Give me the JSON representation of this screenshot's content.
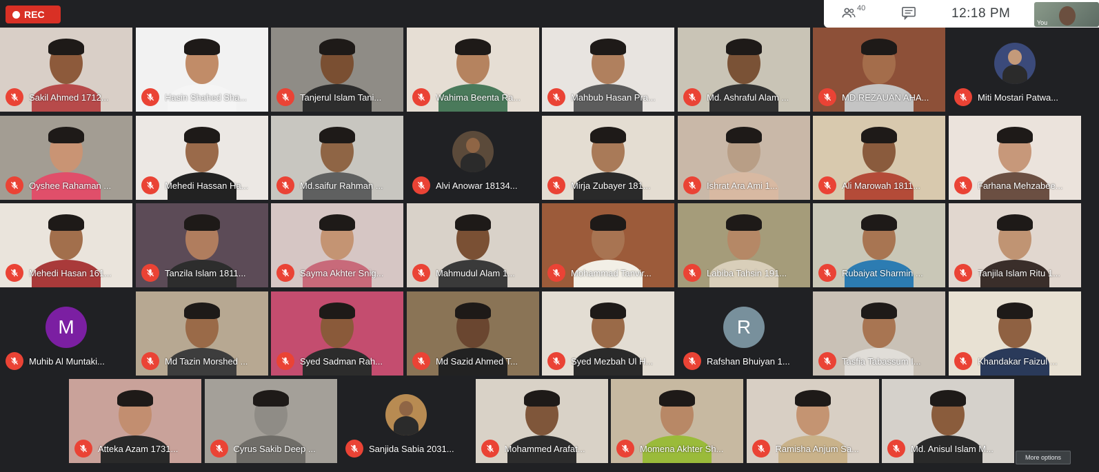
{
  "recording": {
    "label": "REC",
    "color": "#d93025"
  },
  "topbar": {
    "people_icon": "people-icon",
    "participant_count": "40",
    "chat_icon": "chat-icon",
    "time": "12:18 PM",
    "self_label": "You"
  },
  "more_options": "More options",
  "colors": {
    "background": "#202124",
    "mic_off": "#ea4335",
    "avatar_m": "#7b1fa2",
    "avatar_r": "#78909c"
  },
  "participants": [
    {
      "name": "Sakil Ahmed 1712...",
      "bg": "#d9cfc7",
      "skin": "#8d5a3b",
      "shirt": "#b74a4a"
    },
    {
      "name": "Hasin Shahed Sha...",
      "bg": "#f2f2f2",
      "skin": "#c18c68",
      "shirt": "#f5f5f5"
    },
    {
      "name": "Tanjerul Islam Tani...",
      "bg": "#8f8c86",
      "skin": "#7a4f32",
      "shirt": "#2d2d2d"
    },
    {
      "name": "Wahima Beenta Ra...",
      "bg": "#e6ded4",
      "skin": "#b5835f",
      "shirt": "#4a7a5b"
    },
    {
      "name": "Mahbub Hasan Pra...",
      "bg": "#e8e4e0",
      "skin": "#b0805e",
      "shirt": "#5c5c5c"
    },
    {
      "name": "Md. Ashraful Alam ...",
      "bg": "#c9c4b6",
      "skin": "#7a5236",
      "shirt": "#333333"
    },
    {
      "name": "MD.REZAUAN AHA...",
      "bg": "#8d5038",
      "skin": "#a46d4b",
      "shirt": "#c4c4c4"
    },
    {
      "name": "Miti Mostari Patwa...",
      "bg": "#202124",
      "skin": "#c49a7a",
      "shirt": "#3b4a7a",
      "avatar": true
    },
    {
      "name": "Oyshee Rahaman ...",
      "bg": "#a39d93",
      "skin": "#c99474",
      "shirt": "#e04f6a"
    },
    {
      "name": "Mehedi Hassan Ha...",
      "bg": "#ece8e4",
      "skin": "#9a6a4a",
      "shirt": "#222222"
    },
    {
      "name": "Md.saifur Rahman ...",
      "bg": "#c8c6c0",
      "skin": "#8f6545",
      "shirt": "#5f6060"
    },
    {
      "name": "Alvi Anowar 18134...",
      "bg": "#202124",
      "skin": "#8f6545",
      "shirt": "#5b4a3a",
      "avatar": true
    },
    {
      "name": "Mirja Zubayer 181...",
      "bg": "#e4ddd2",
      "skin": "#a97a58",
      "shirt": "#2a2a2a"
    },
    {
      "name": "Ishrat Ara Ami 1...",
      "bg": "#c9b8a8",
      "skin": "#b89e86",
      "shirt": "#d8b9a2"
    },
    {
      "name": "Ali Marowah 1811...",
      "bg": "#d8c9ae",
      "skin": "#8a5b3d",
      "shirt": "#b44b38"
    },
    {
      "name": "Farhana Mehzabee...",
      "bg": "#ebe3dc",
      "skin": "#c7987a",
      "shirt": "#6b4f42"
    },
    {
      "name": "Mehedi Hasan 161...",
      "bg": "#eae4dc",
      "skin": "#a26f4c",
      "shirt": "#a93a3a"
    },
    {
      "name": "Tanzila Islam 1811...",
      "bg": "#5c4b57",
      "skin": "#b07d5e",
      "shirt": "#2d2d2d"
    },
    {
      "name": "Sayma Akhter Snig...",
      "bg": "#d6c6c4",
      "skin": "#c49473",
      "shirt": "#c86a7a"
    },
    {
      "name": "Mahmudul Alam 1...",
      "bg": "#d9d2c9",
      "skin": "#7a5034",
      "shirt": "#3a3a3a"
    },
    {
      "name": "Mohammad Tanvir...",
      "bg": "#9c5b3a",
      "skin": "#a87452",
      "shirt": "#f2efe6"
    },
    {
      "name": "Labiba Tahsin 191...",
      "bg": "#a59c7a",
      "skin": "#b58866",
      "shirt": "#d9cfba"
    },
    {
      "name": "Rubaiyat Sharmin ...",
      "bg": "#c9c7b7",
      "skin": "#a87552",
      "shirt": "#2c7cb2"
    },
    {
      "name": "Tanjila Islam Ritu 1...",
      "bg": "#e1d7cf",
      "skin": "#c09473",
      "shirt": "#3a2e2a"
    },
    {
      "name": "Muhib Al Muntaki...",
      "bg": "#202124",
      "letter": "M",
      "avatar_color": "#7b1fa2"
    },
    {
      "name": "Md Tazin Morshed ...",
      "bg": "#b7a892",
      "skin": "#9a6a48",
      "shirt": "#3d3d3d"
    },
    {
      "name": "Syed Sadman Rah...",
      "bg": "#c44d6f",
      "skin": "#8a5a3a",
      "shirt": "#2c2c2c"
    },
    {
      "name": "Md Sazid Ahmed T...",
      "bg": "#8a7456",
      "skin": "#6a4630",
      "shirt": "#222222"
    },
    {
      "name": "Syed Mezbah Ul H...",
      "bg": "#e3ddd3",
      "skin": "#9a6a48",
      "shirt": "#2a2a2a"
    },
    {
      "name": "Rafshan Bhuiyan 1...",
      "bg": "#202124",
      "letter": "R",
      "avatar_color": "#78909c"
    },
    {
      "name": "Tasfia Tabassum I...",
      "bg": "#c9c1b6",
      "skin": "#a87552",
      "shirt": "#e0ddd8"
    },
    {
      "name": "Khandakar Faizul ...",
      "bg": "#e8e1d3",
      "skin": "#8f6142",
      "shirt": "#2a3a5a"
    },
    {
      "name": "Atteka Azam 1731...",
      "bg": "#c9a29a",
      "skin": "#c28e70",
      "shirt": "#2a2a2a"
    },
    {
      "name": "Cyrus Sakib Deep ...",
      "bg": "#a4a099",
      "skin": "#8f8c86",
      "shirt": "#6f6d68"
    },
    {
      "name": "Sanjida Sabia 2031...",
      "bg": "#202124",
      "skin": "#8f6545",
      "shirt": "#b88b52",
      "avatar": true
    },
    {
      "name": "Mohammed Arafat...",
      "bg": "#d9d2c7",
      "skin": "#7f563a",
      "shirt": "#2d2d2d"
    },
    {
      "name": "Momena Akhter Sh...",
      "bg": "#c7b9a1",
      "skin": "#b88866",
      "shirt": "#9abb3a"
    },
    {
      "name": "Ramisha Anjum Sa...",
      "bg": "#d8cfc4",
      "skin": "#c49472",
      "shirt": "#c9b28a"
    },
    {
      "name": "Md. Anisul Islam M...",
      "bg": "#d5d1cb",
      "skin": "#8a5c3c",
      "shirt": "#2a2a2a"
    }
  ]
}
